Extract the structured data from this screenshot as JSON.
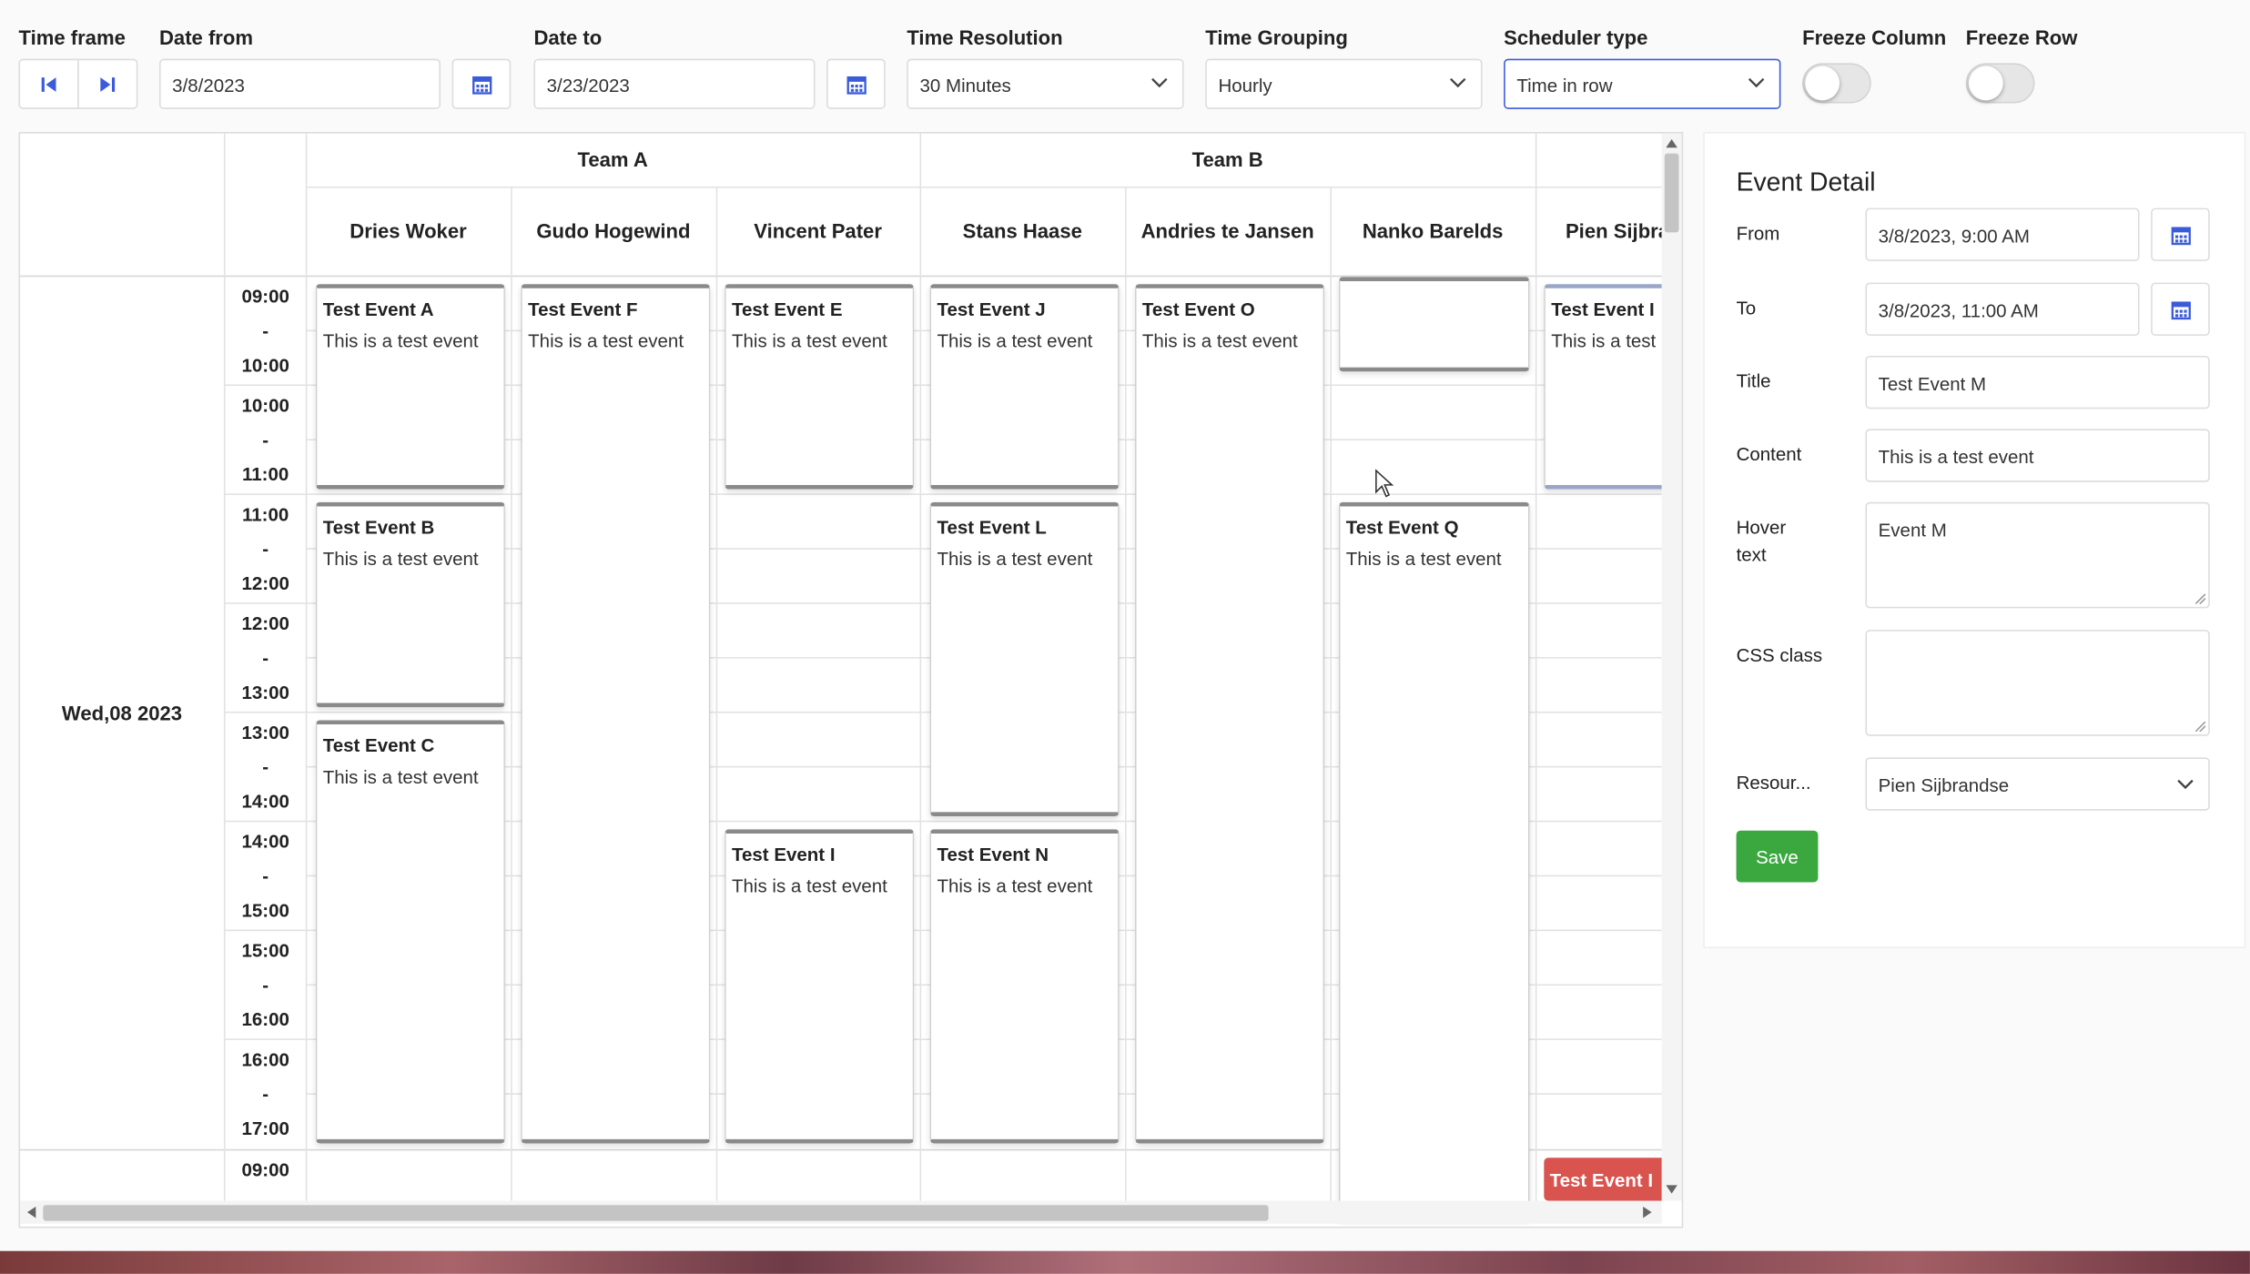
{
  "toolbar": {
    "time_frame_label": "Time frame",
    "date_from_label": "Date from",
    "date_from_value": "3/8/2023",
    "date_to_label": "Date to",
    "date_to_value": "3/23/2023",
    "time_resolution_label": "Time Resolution",
    "time_resolution_value": "30 Minutes",
    "time_grouping_label": "Time Grouping",
    "time_grouping_value": "Hourly",
    "scheduler_type_label": "Scheduler type",
    "scheduler_type_value": "Time in row",
    "freeze_column_label": "Freeze Column",
    "freeze_row_label": "Freeze Row"
  },
  "scheduler": {
    "teams": [
      "Team A",
      "Team B"
    ],
    "resources": [
      "Dries Woker",
      "Gudo Hogewind",
      "Vincent Pater",
      "Stans Haase",
      "Andries te Jansen",
      "Nanko Barelds",
      "Pien Sijbra"
    ],
    "date_label": "Wed,08 2023",
    "time_slots": [
      {
        "start": "09:00",
        "sep": "-",
        "end": "10:00"
      },
      {
        "start": "10:00",
        "sep": "-",
        "end": "11:00"
      },
      {
        "start": "11:00",
        "sep": "-",
        "end": "12:00"
      },
      {
        "start": "12:00",
        "sep": "-",
        "end": "13:00"
      },
      {
        "start": "13:00",
        "sep": "-",
        "end": "14:00"
      },
      {
        "start": "14:00",
        "sep": "-",
        "end": "15:00"
      },
      {
        "start": "15:00",
        "sep": "-",
        "end": "16:00"
      },
      {
        "start": "16:00",
        "sep": "-",
        "end": "17:00"
      }
    ],
    "next_day_time": "09:00",
    "events": [
      {
        "title": "Test Event A",
        "content": "This is a test event"
      },
      {
        "title": "Test Event B",
        "content": "This is a test event"
      },
      {
        "title": "Test Event C",
        "content": "This is a test event"
      },
      {
        "title": "Test Event F",
        "content": "This is a test event"
      },
      {
        "title": "Test Event E",
        "content": "This is a test event"
      },
      {
        "title": "Test Event I",
        "content": "This is a test event"
      },
      {
        "title": "Test Event J",
        "content": "This is a test event"
      },
      {
        "title": "Test Event L",
        "content": "This is a test event"
      },
      {
        "title": "Test Event N",
        "content": "This is a test event"
      },
      {
        "title": "Test Event O",
        "content": "This is a test event"
      },
      {
        "title": "",
        "content": ""
      },
      {
        "title": "Test Event Q",
        "content": "This is a test event"
      },
      {
        "title": "Test Event I",
        "content": "This is a test"
      }
    ],
    "bottom_event_title": "Test Event I",
    "bottom_event_color": "#d9534f"
  },
  "detail": {
    "heading": "Event Detail",
    "from_label": "From",
    "from_value": "3/8/2023, 9:00 AM",
    "to_label": "To",
    "to_value": "3/8/2023, 11:00 AM",
    "title_label": "Title",
    "title_value": "Test Event M",
    "content_label": "Content",
    "content_value": "This is a test event",
    "hover_label_1": "Hover",
    "hover_label_2": "text",
    "hover_value": "Event M",
    "css_label": "CSS class",
    "css_value": "",
    "resource_label": "Resour...",
    "resource_value": "Pien Sijbrandse",
    "save_label": "Save",
    "save_color": "#3aa83f"
  },
  "colors": {
    "accent": "#3b5bdb"
  }
}
